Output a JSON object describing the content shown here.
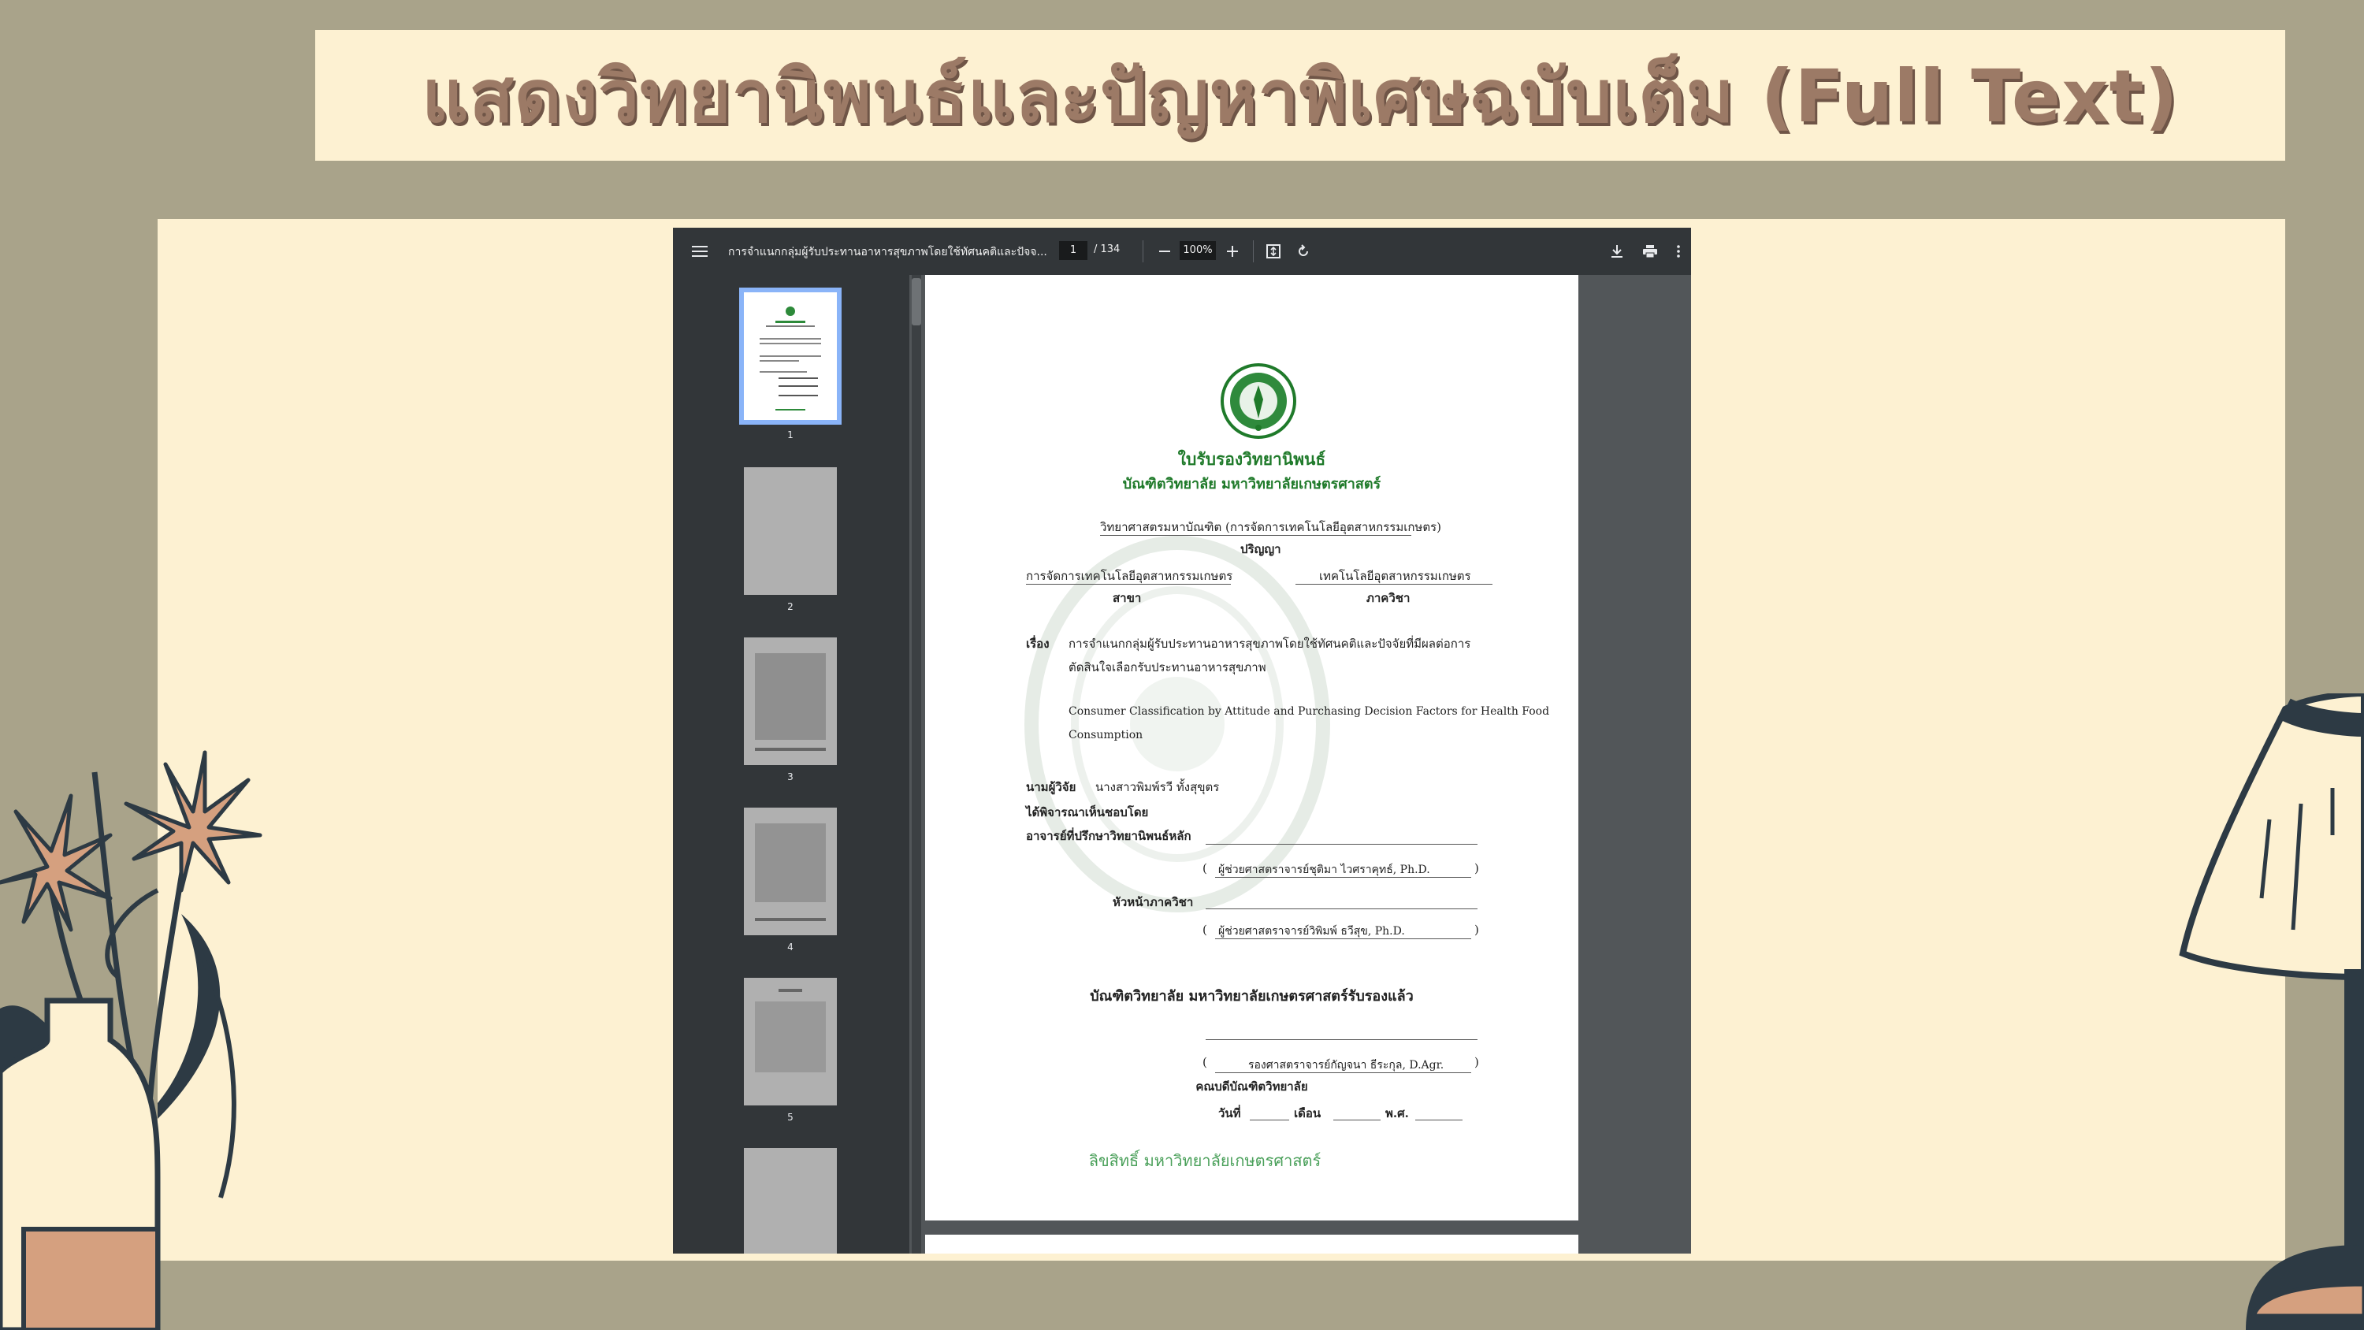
{
  "slide": {
    "title": "แสดงวิทยานิพนธ์และปัญหาพิเศษฉบับเต็ม (Full Text)"
  },
  "viewer": {
    "doc_title": "การจำแนกกลุ่มผู้รับประทานอาหารสุขภาพโดยใช้ทัศนคติและปัจจ...",
    "page_current": "1",
    "page_total": "/ 134",
    "zoom": "100%",
    "icons": [
      "menu-icon",
      "zoom-out-icon",
      "zoom-in-icon",
      "fit-page-icon",
      "rotate-icon",
      "download-icon",
      "print-icon",
      "more-icon"
    ],
    "thumbnails": [
      {
        "label": "1"
      },
      {
        "label": "2"
      },
      {
        "label": "3"
      },
      {
        "label": "4"
      },
      {
        "label": "5"
      }
    ]
  },
  "document": {
    "heading": "ใบรับรองวิทยานิพนธ์",
    "subheading": "บัณฑิตวิทยาลัย มหาวิทยาลัยเกษตรศาสตร์",
    "degree": "วิทยาศาสตรมหาบัณฑิต (การจัดการเทคโนโลยีอุตสาหกรรมเกษตร)",
    "degree_label": "ปริญญา",
    "major": "การจัดการเทคโนโลยีอุตสาหกรรมเกษตร",
    "major_label": "สาขา",
    "department": "เทคโนโลยีอุตสาหกรรมเกษตร",
    "department_label": "ภาควิชา",
    "topic_label": "เรื่อง",
    "topic_th_line1": "การจำแนกกลุ่มผู้รับประทานอาหารสุขภาพโดยใช้ทัศนคติและปัจจัยที่มีผลต่อการ",
    "topic_th_line2": "ตัดสินใจเลือกรับประทานอาหารสุขภาพ",
    "topic_en_line1": "Consumer Classification by Attitude and Purchasing Decision Factors for Health Food",
    "topic_en_line2": "Consumption",
    "researcher_label": "นามผู้วิจัย",
    "researcher": "นางสาวพิมพ์รวี ทั้งสุขุตร",
    "considered_by": "ได้พิจารณาเห็นชอบโดย",
    "advisor_label": "อาจารย์ที่ปรึกษาวิทยานิพนธ์หลัก",
    "advisor_name": "ผู้ช่วยศาสตราจารย์ชุติมา ไวศราคุทธ์, Ph.D.",
    "head_label": "หัวหน้าภาควิชา",
    "head_name": "ผู้ช่วยศาสตราจารย์วิพิมพ์ ธวีสุข, Ph.D.",
    "certified": "บัณฑิตวิทยาลัย มหาวิทยาลัยเกษตรศาสตร์รับรองแล้ว",
    "dean_name": "รองศาสตราจารย์กัญจนา ธีระกุล, D.Agr.",
    "dean_label": "คณบดีบัณฑิตวิทยาลัย",
    "date_label": "วันที่",
    "month_label": "เดือน",
    "year_label": "พ.ศ.",
    "copyright": "ลิขสิทธิ์ มหาวิทยาลัยเกษตรศาสตร์"
  },
  "colors": {
    "background": "#a9a38a",
    "panel": "#fdf1d2",
    "title_text": "#9c7a66",
    "doc_green": "#1f7a2a"
  }
}
